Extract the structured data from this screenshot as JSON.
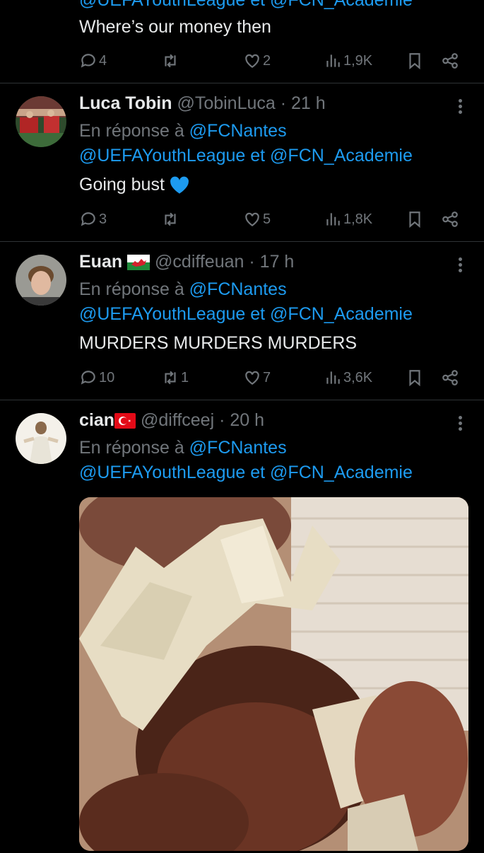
{
  "top_tweet": {
    "cut_mention": "@UEFAYouthLeague et @FCN_Academie",
    "text": "Where’s our money then",
    "replies": "4",
    "retweets": "",
    "likes": "2",
    "views": "1,9K"
  },
  "tweets": [
    {
      "name": "Luca Tobin",
      "handle": "@TobinLuca",
      "time": "· 21 h",
      "reply_prefix": "En réponse à",
      "reply_to": "@FCNantes",
      "reply_line2_a": "@UEFAYouthLeague",
      "reply_line2_sep": "et",
      "reply_line2_b": "@FCN_Academie",
      "text": "Going bust",
      "replies": "3",
      "retweets": "",
      "likes": "5",
      "views": "1,8K"
    },
    {
      "name": "Euan",
      "handle": "@cdiffeuan",
      "time": "· 17 h",
      "reply_prefix": "En réponse à",
      "reply_to": "@FCNantes",
      "reply_line2_a": "@UEFAYouthLeague",
      "reply_line2_sep": "et",
      "reply_line2_b": "@FCN_Academie",
      "text": "MURDERS MURDERS MURDERS",
      "replies": "10",
      "retweets": "1",
      "likes": "7",
      "views": "3,6K"
    },
    {
      "name": "cian",
      "handle": "@diffceej",
      "time": "· 20 h",
      "reply_prefix": "En réponse à",
      "reply_to": "@FCNantes",
      "reply_line2_a": "@UEFAYouthLeague",
      "reply_line2_sep": "et",
      "reply_line2_b": "@FCN_Academie"
    }
  ],
  "colors": {
    "background": "#000000",
    "accent": "#1d9bf0",
    "muted": "#71767b",
    "divider": "#2f3336"
  }
}
